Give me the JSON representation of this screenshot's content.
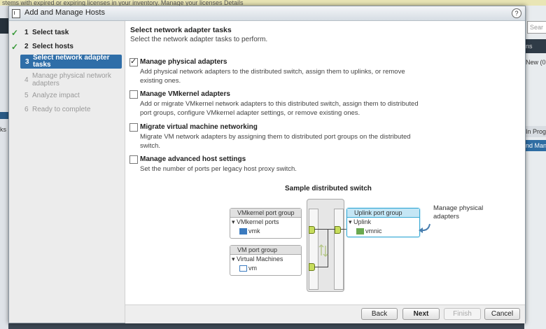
{
  "background": {
    "top_banner": "stems with expired or expiring licenses in your inventory.  Manage your licenses  Details",
    "left_fragment": "ks",
    "right_search_placeholder": "Sear",
    "right_header": "ns",
    "right_new": "New (0",
    "right_inprog": "In Prog",
    "right_selected": "nd Man"
  },
  "dialog": {
    "title": "Add and Manage Hosts",
    "help_icon": "?"
  },
  "steps": [
    {
      "num": "1",
      "label": "Select task",
      "state": "done"
    },
    {
      "num": "2",
      "label": "Select hosts",
      "state": "done"
    },
    {
      "num": "3",
      "label": "Select network adapter tasks",
      "state": "active"
    },
    {
      "num": "4",
      "label": "Manage physical network adapters",
      "state": "disabled"
    },
    {
      "num": "5",
      "label": "Analyze impact",
      "state": "disabled"
    },
    {
      "num": "6",
      "label": "Ready to complete",
      "state": "disabled"
    }
  ],
  "content": {
    "header": "Select network adapter tasks",
    "subheader": "Select the network adapter tasks to perform.",
    "options": [
      {
        "title": "Manage physical adapters",
        "desc": "Add physical network adapters to the distributed switch, assign them to uplinks, or remove existing ones.",
        "checked": true
      },
      {
        "title": "Manage VMkernel adapters",
        "desc": "Add or migrate VMkernel network adapters to this distributed switch, assign them to distributed port groups, configure VMkernel adapter settings, or remove existing ones.",
        "checked": false
      },
      {
        "title": "Migrate virtual machine networking",
        "desc": "Migrate VM network adapters by assigning them to distributed port groups on the distributed switch.",
        "checked": false
      },
      {
        "title": "Manage advanced host settings",
        "desc": "Set the number of ports per legacy host proxy switch.",
        "checked": false
      }
    ]
  },
  "diagram": {
    "title": "Sample distributed switch",
    "vmkernel_group": "VMkernel port group",
    "vmkernel_ports": "VMkernel ports",
    "vmk": "vmk",
    "vm_group": "VM port group",
    "virtual_machines": "Virtual Machines",
    "vm": "vm",
    "uplink_group": "Uplink port group",
    "uplink": "Uplink",
    "vmnic": "vmnic",
    "callout": "Manage physical adapters"
  },
  "buttons": {
    "back": "Back",
    "next": "Next",
    "finish": "Finish",
    "cancel": "Cancel"
  },
  "colors": {
    "active_step": "#2f6ea8",
    "check_green": "#3a9a3a",
    "uplink_accent": "#37a9d4",
    "port_green": "#c7dd5c"
  }
}
